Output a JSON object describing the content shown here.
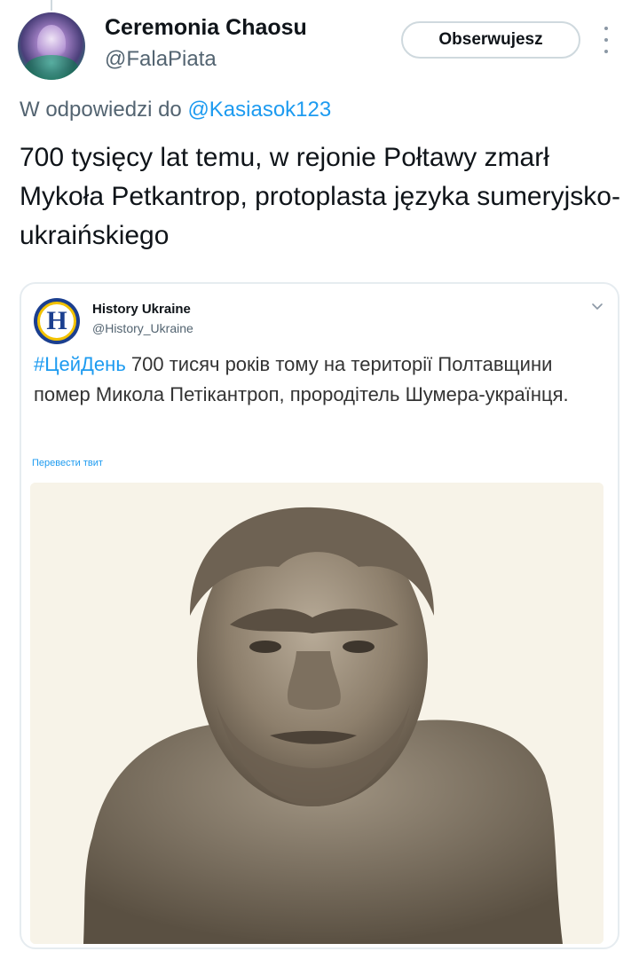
{
  "post": {
    "author": {
      "display_name": "Ceremonia Chaosu",
      "handle": "@FalaPiata"
    },
    "follow_label": "Obserwujesz",
    "reply_prefix": "W odpowiedzi do",
    "reply_handle": "@Kasiasok123",
    "text": "700 tysięcy lat temu, w rejonie Połtawy zmarł Mykoła Petkantrop, protoplasta języka sumeryjsko-ukraińskiego"
  },
  "quoted": {
    "logo_letter": "H",
    "display_name": "History Ukraine",
    "handle": "@History_Ukraine",
    "hashtag": "#ЦейДень",
    "text": " 700 тисяч років тому на території Полтавщини помер Микола Петікантроп, прородітель Шумера-українця.",
    "translate_label": "Перевести твит",
    "image_icon": "sculpture-bust-photo"
  },
  "colors": {
    "link_blue": "#1d9bf0",
    "secondary_text": "#536471",
    "primary_text": "#0f1419",
    "border": "#cfd9de",
    "logo_navy": "#1b3f8f",
    "logo_gold": "#f2c200"
  }
}
